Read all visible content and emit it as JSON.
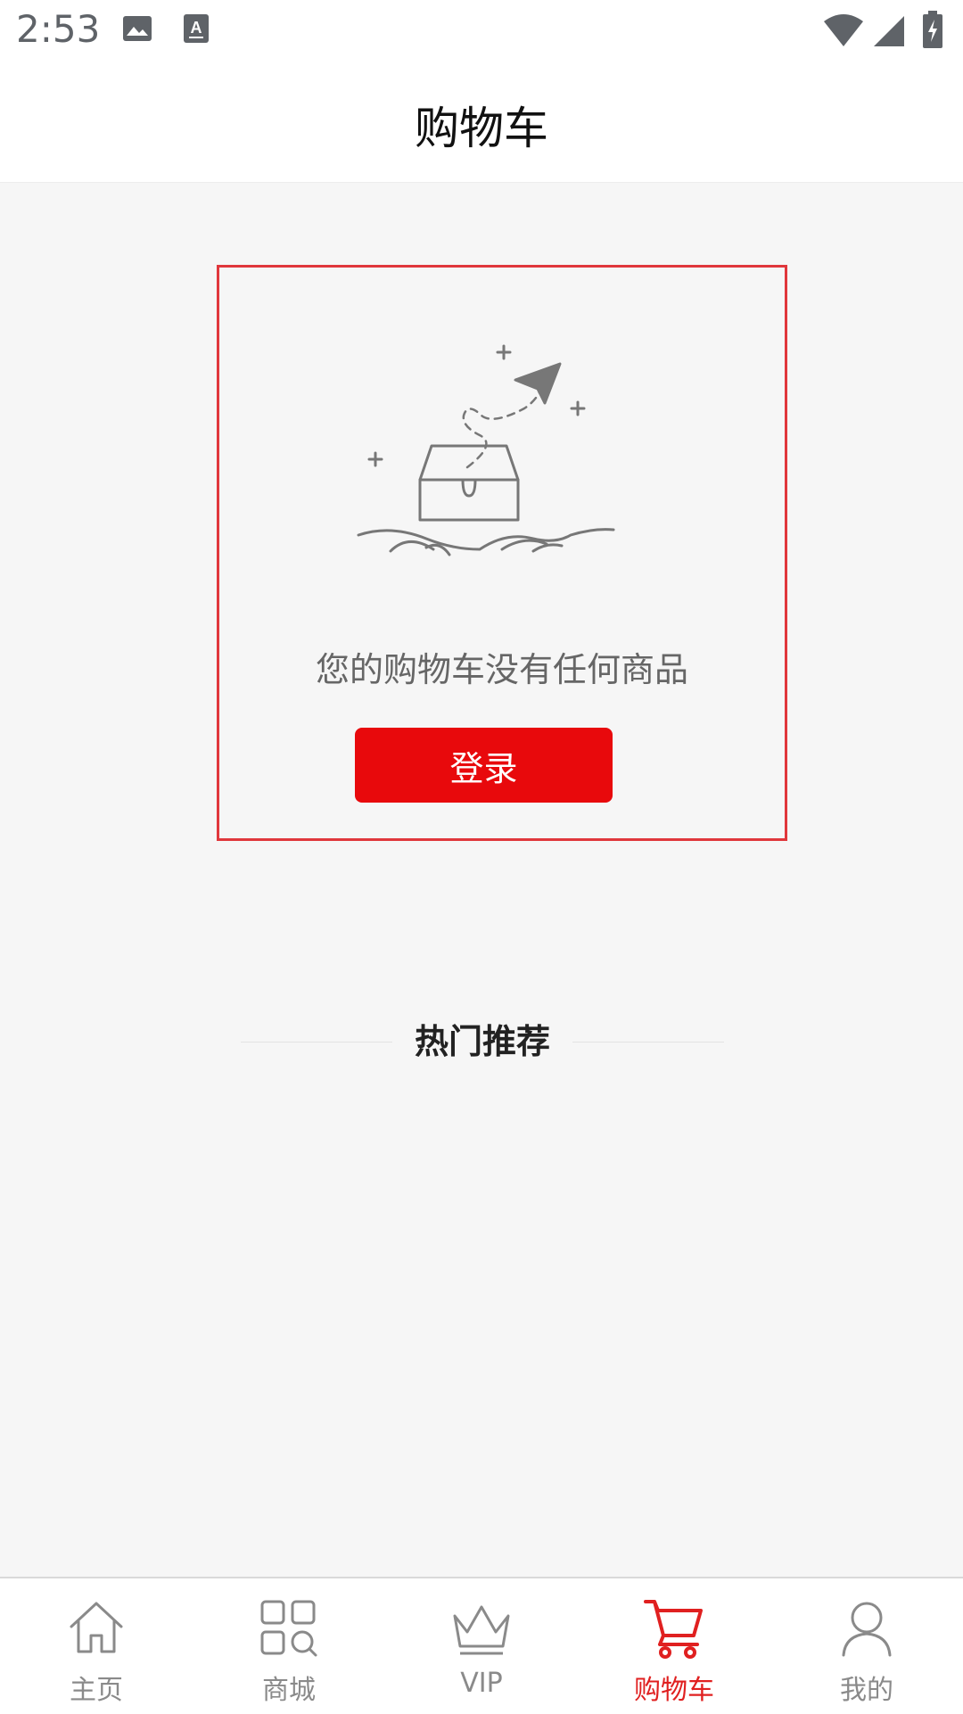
{
  "status_bar": {
    "time": "2:53",
    "icons": [
      "image-icon",
      "text-recognition-icon",
      "wifi-icon",
      "signal-icon",
      "battery-charging-icon"
    ]
  },
  "header": {
    "title": "购物车"
  },
  "empty_state": {
    "illustration": "empty-box-paper-plane-illustration",
    "message": "您的购物车没有任何商品",
    "login_label": "登录"
  },
  "recommend": {
    "title": "热门推荐"
  },
  "tab_bar": {
    "active_color": "#e02020",
    "inactive_color": "#8a8a8a",
    "items": [
      {
        "label": "主页",
        "icon": "home-icon"
      },
      {
        "label": "商城",
        "icon": "grid-search-icon"
      },
      {
        "label": "VIP",
        "icon": "crown-icon"
      },
      {
        "label": "购物车",
        "icon": "cart-icon",
        "active": true
      },
      {
        "label": "我的",
        "icon": "user-icon"
      }
    ]
  }
}
